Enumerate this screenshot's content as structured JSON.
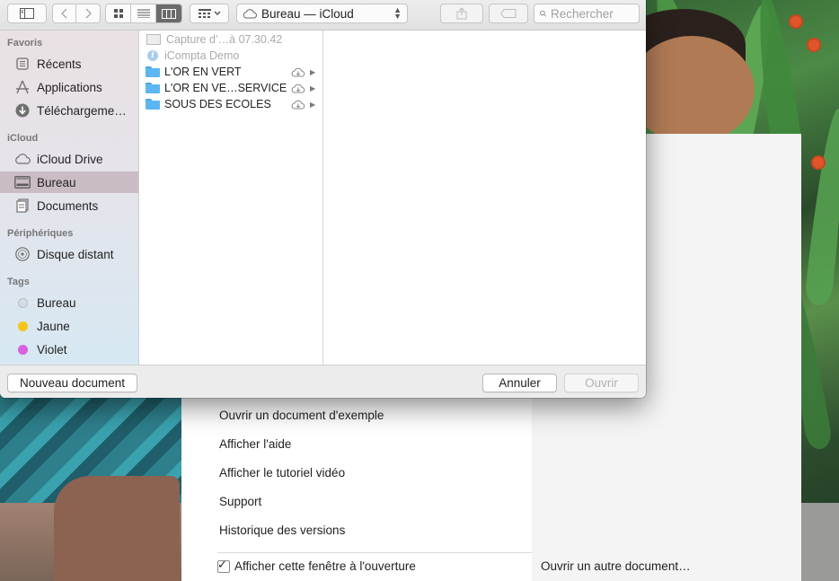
{
  "colors": {
    "sidebar_selection": "#c9bcc4",
    "folder_blue": "#5cb6f2",
    "tag_bureau": "#d6dce3",
    "tag_jaune": "#f5c518",
    "tag_violet": "#d75fe0"
  },
  "toolbar": {
    "location": "Bureau — iCloud",
    "search_placeholder": "Rechercher",
    "icons": [
      "sidebar-toggle-icon",
      "back-icon",
      "forward-icon",
      "icon-view-icon",
      "list-view-icon",
      "column-view-icon",
      "group-icon",
      "cloud-icon",
      "share-icon",
      "tag-icon",
      "search-icon"
    ]
  },
  "sidebar": {
    "sections": [
      {
        "title": "Favoris",
        "items": [
          {
            "label": "Récents",
            "icon": "recents-icon"
          },
          {
            "label": "Applications",
            "icon": "applications-icon"
          },
          {
            "label": "Téléchargeme…",
            "icon": "downloads-icon"
          }
        ]
      },
      {
        "title": "iCloud",
        "items": [
          {
            "label": "iCloud Drive",
            "icon": "cloud-icon"
          },
          {
            "label": "Bureau",
            "icon": "desktop-icon",
            "selected": true
          },
          {
            "label": "Documents",
            "icon": "documents-icon"
          }
        ]
      },
      {
        "title": "Périphériques",
        "items": [
          {
            "label": "Disque distant",
            "icon": "disc-icon"
          }
        ]
      },
      {
        "title": "Tags",
        "items": [
          {
            "label": "Bureau",
            "icon": "tag-dot"
          },
          {
            "label": "Jaune",
            "icon": "tag-dot"
          },
          {
            "label": "Violet",
            "icon": "tag-dot"
          }
        ]
      }
    ]
  },
  "files": [
    {
      "name": "Capture d’…à 07.30.42",
      "kind": "image",
      "dimmed": true
    },
    {
      "name": "iCompta Demo",
      "kind": "info",
      "dimmed": true
    },
    {
      "name": "L'OR EN VERT",
      "kind": "folder",
      "icloud": true
    },
    {
      "name": "L'OR EN VE…SERVICES",
      "kind": "folder",
      "icloud": true
    },
    {
      "name": "SOUS DES ECOLES",
      "kind": "folder",
      "icloud": true
    }
  ],
  "buttons": {
    "new_document": "Nouveau document",
    "cancel": "Annuler",
    "open": "Ouvrir"
  },
  "welcome": {
    "menu": [
      "Ouvrir un document d'exemple",
      "Afficher l'aide",
      "Afficher le tutoriel vidéo",
      "Support",
      "Historique des versions"
    ],
    "show_on_open_label": "Afficher cette fenêtre à l'ouverture",
    "show_on_open_checked": true,
    "open_other_label": "Ouvrir un autre document…"
  }
}
